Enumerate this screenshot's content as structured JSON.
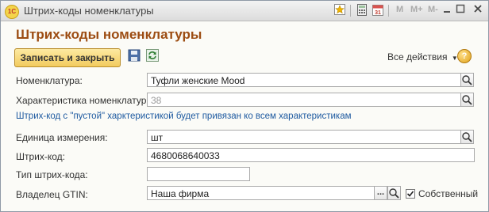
{
  "window": {
    "title": "Штрих-коды номенклатуры",
    "toolbar_m1": "M",
    "toolbar_m2": "M+",
    "toolbar_m3": "M-"
  },
  "form": {
    "heading": "Штрих-коды номенклатуры",
    "save_close_label": "Записать и закрыть",
    "all_actions_label": "Все действия",
    "help_label": "?"
  },
  "fields": {
    "nomenclature": {
      "label": "Номенклатура:",
      "value": "Туфли женские Mood"
    },
    "characteristic": {
      "label": "Характеристика номенклатуры:",
      "value": "38"
    },
    "hint": "Штрих-код с \"пустой\" харктеристикой будет привязан ко всем характеристикам",
    "unit": {
      "label": "Единица измерения:",
      "value": "шт"
    },
    "barcode": {
      "label": "Штрих-код:",
      "value": "4680068640033"
    },
    "barcode_type": {
      "label": "Тип штрих-кода:",
      "value": ""
    },
    "gtin_owner": {
      "label": "Владелец GTIN:",
      "value": "Наша фирма",
      "dots_label": "..."
    },
    "own_checkbox": {
      "label": "Собственный",
      "checked": true
    }
  },
  "icons": {
    "app": "1c-app-icon",
    "favorite": "star-icon",
    "calc": "calculator-icon",
    "calendar": "calendar-icon",
    "minimize": "minimize-icon",
    "maximize": "maximize-icon",
    "close": "close-icon",
    "save": "floppy-icon",
    "refresh": "refresh-icon",
    "search": "search-icon",
    "dropdown": "chevron-down-icon"
  },
  "colors": {
    "heading": "#9c4c12",
    "primary_button": "#f2cb5e",
    "hint": "#1e5aa0"
  }
}
